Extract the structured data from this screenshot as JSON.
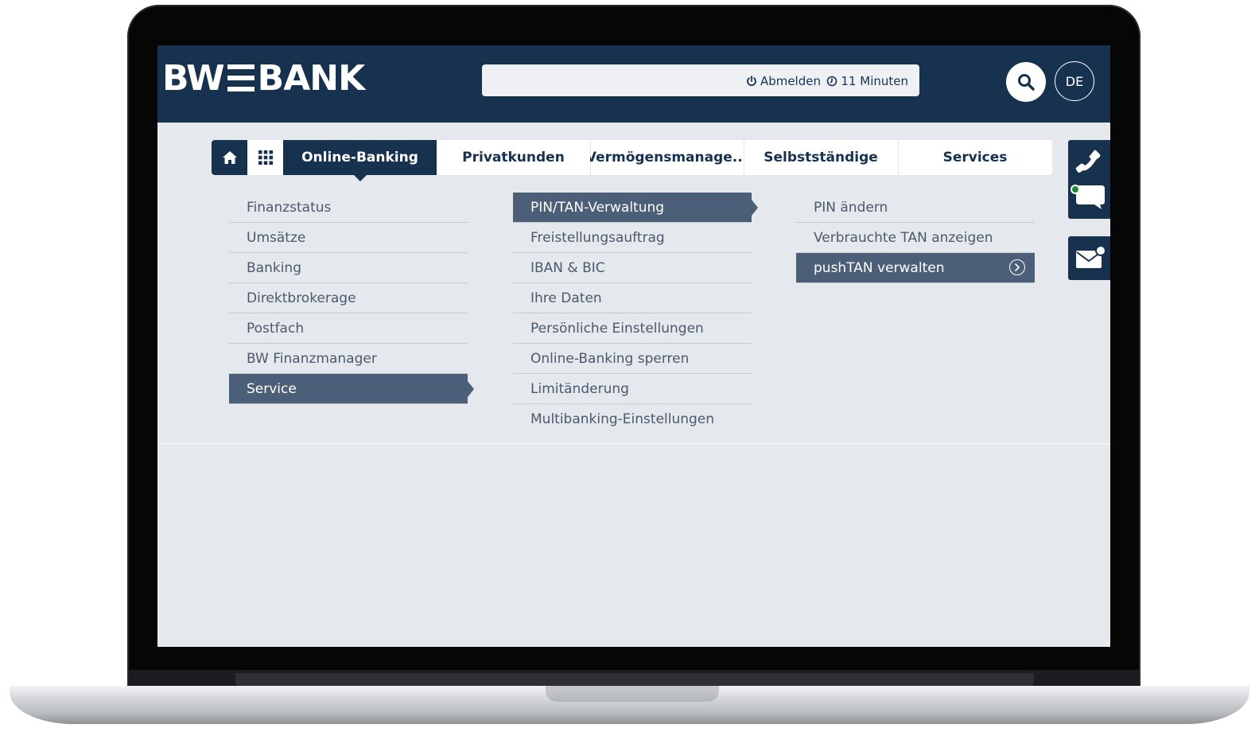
{
  "header": {
    "logo_left": "BW",
    "logo_right": "BANK",
    "logout_label": "Abmelden",
    "session_timer": "11 Minuten",
    "language": "DE"
  },
  "topnav": {
    "tabs": [
      {
        "label": "Online-Banking",
        "active": true
      },
      {
        "label": "Privatkunden"
      },
      {
        "label": "Vermögensmanage..."
      },
      {
        "label": "Selbstständige"
      },
      {
        "label": "Services"
      }
    ]
  },
  "menu": {
    "level1": [
      "Finanzstatus",
      "Umsätze",
      "Banking",
      "Direktbrokerage",
      "Postfach",
      "BW Finanzmanager",
      "Service"
    ],
    "level1_active": "Service",
    "level2": [
      "PIN/TAN-Verwaltung",
      "Freistellungsauftrag",
      "IBAN & BIC",
      "Ihre Daten",
      "Persönliche Einstellungen",
      "Online-Banking sperren",
      "Limitänderung",
      "Multibanking-Einstellungen"
    ],
    "level2_active": "PIN/TAN-Verwaltung",
    "level3": [
      "PIN ändern",
      "Verbrauchte TAN anzeigen",
      "pushTAN verwalten"
    ],
    "level3_active": "pushTAN verwalten"
  },
  "colors": {
    "brand_navy": "#17324f",
    "menu_active": "#4c5f78",
    "page_bg": "#e5e8ec",
    "online_status": "#1c8a3a"
  },
  "icons": [
    "home-icon",
    "apps-grid-icon",
    "power-icon",
    "clock-icon",
    "search-icon",
    "phone-icon",
    "chat-icon",
    "mail-icon",
    "chevron-right-circle-icon"
  ]
}
